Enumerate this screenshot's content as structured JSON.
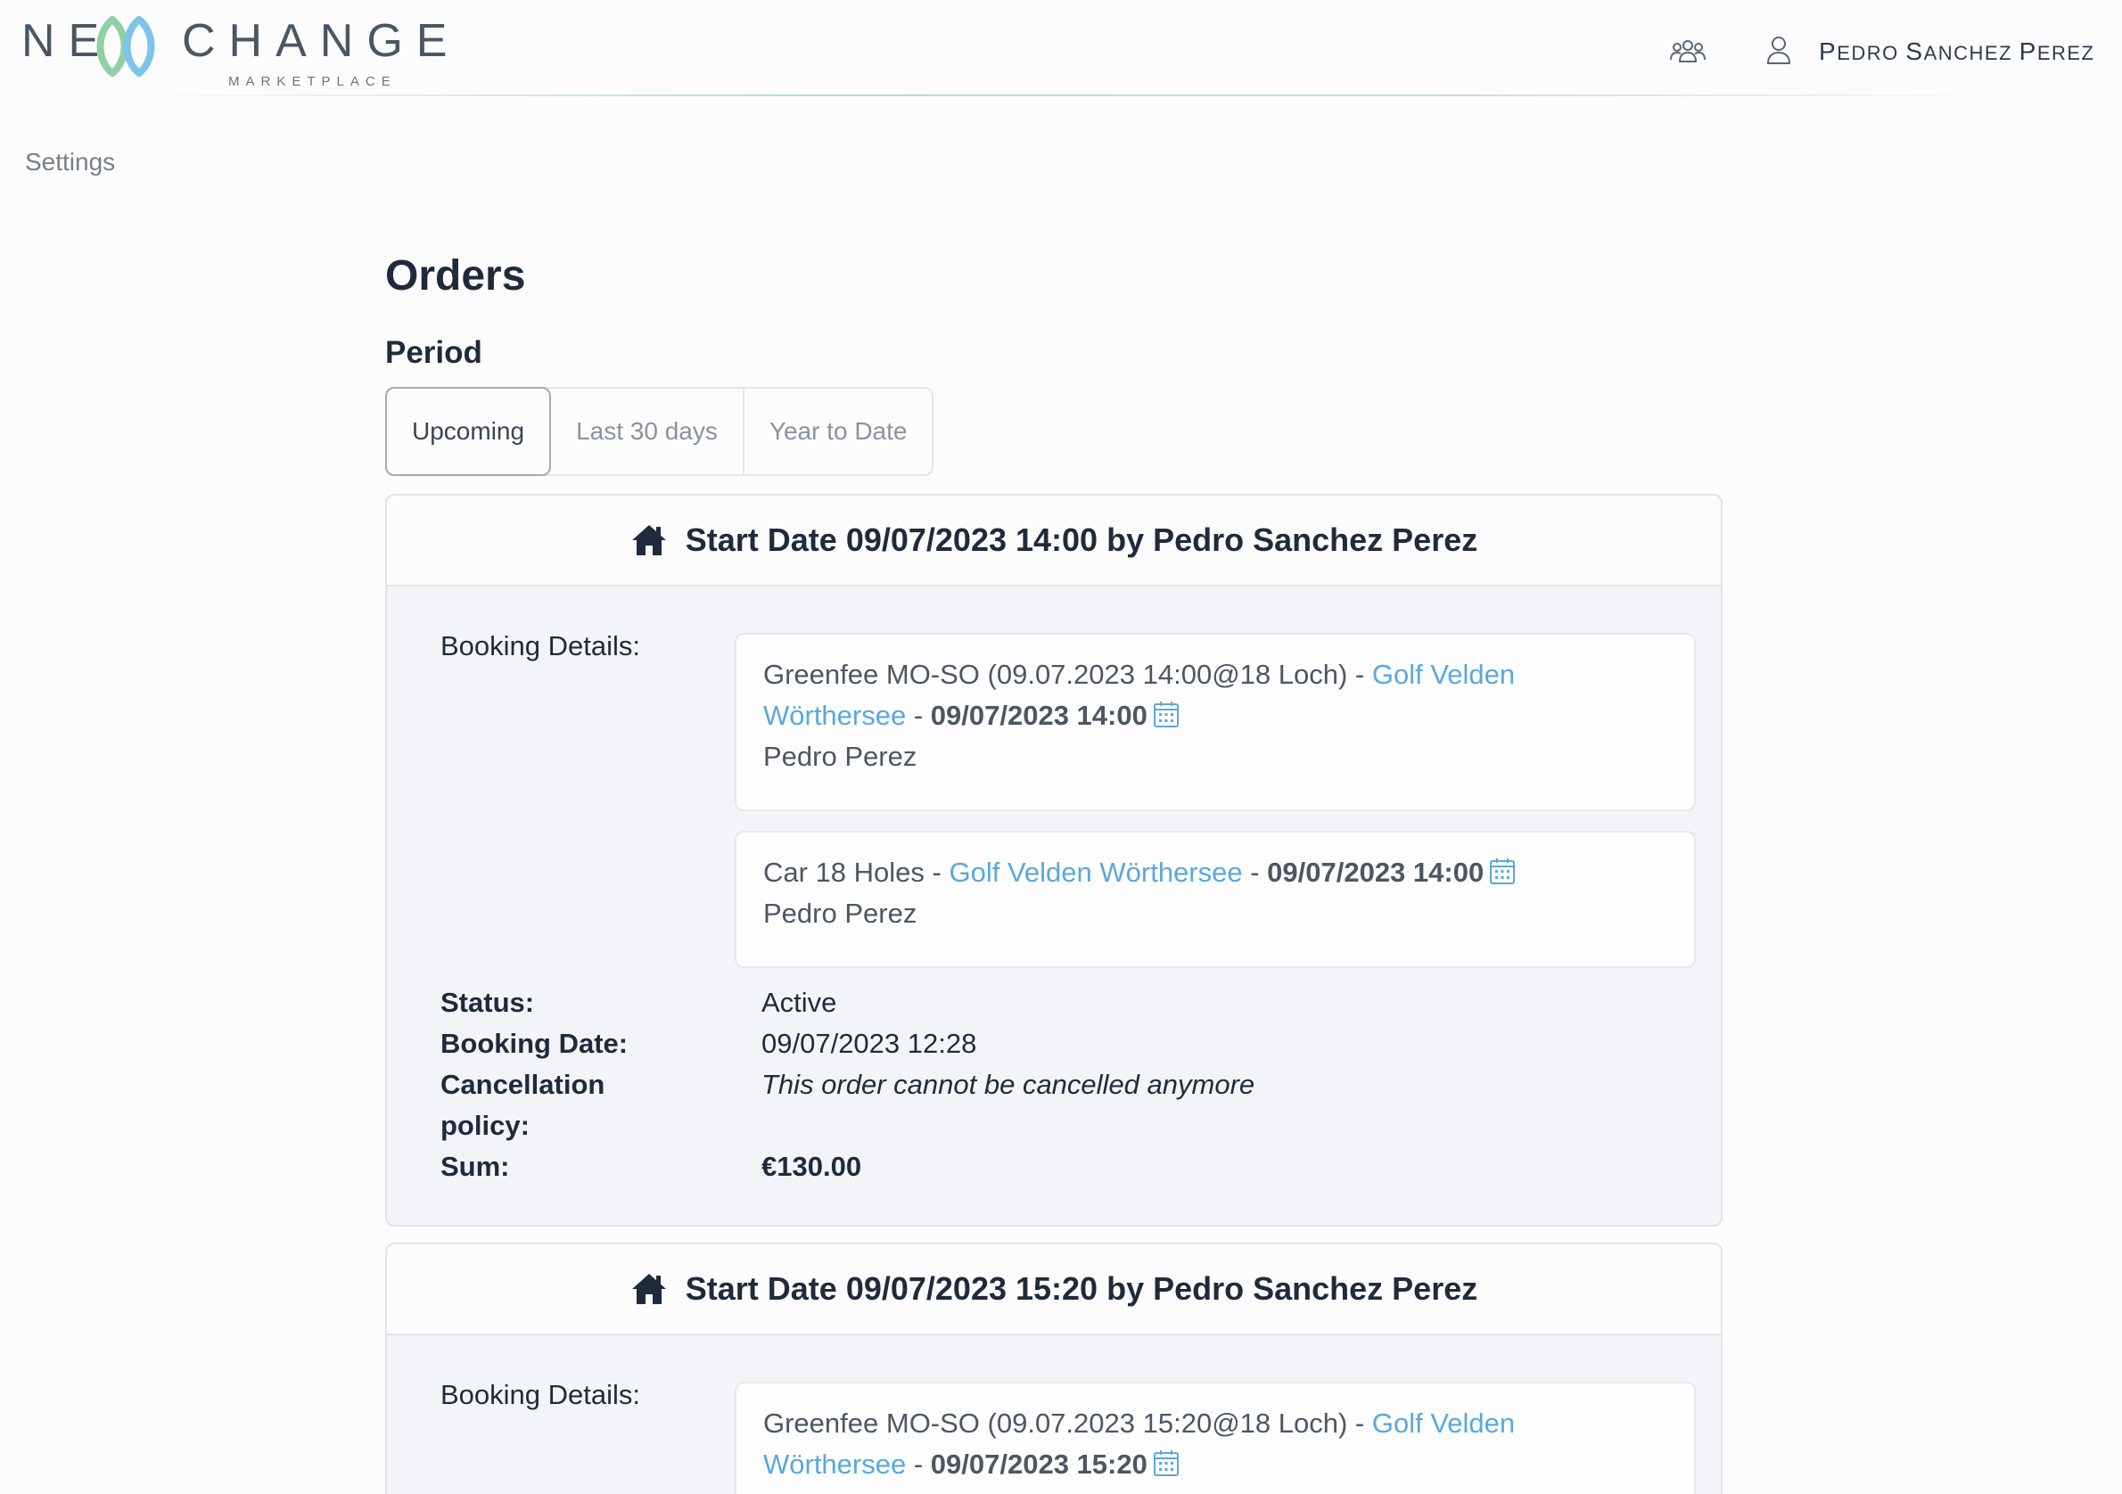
{
  "brand": {
    "logo_text_left": "NE",
    "logo_text_right": "CHANGE",
    "logo_sub": "MARKETPLACE"
  },
  "header": {
    "user_name_parts": [
      {
        "big": "P",
        "small": "EDRO "
      },
      {
        "big": "S",
        "small": "ANCHEZ "
      },
      {
        "big": "P",
        "small": "EREZ"
      }
    ],
    "icons": [
      "group-icon",
      "user-icon"
    ]
  },
  "nav": {
    "settings": "Settings"
  },
  "page": {
    "title": "Orders",
    "period_label": "Period"
  },
  "tabs": [
    {
      "label": "Upcoming",
      "active": true
    },
    {
      "label": "Last 30 days",
      "active": false
    },
    {
      "label": "Year to Date",
      "active": false
    }
  ],
  "orders": [
    {
      "header": "Start Date 09/07/2023 14:00 by Pedro Sanchez Perez",
      "booking_label": "Booking Details:",
      "items": [
        {
          "title": "Greenfee MO-SO (09.07.2023 14:00@18 Loch)",
          "sep1": " - ",
          "venue_line1": "Golf Velden",
          "venue_line2": "Wörthersee",
          "sep2": " - ",
          "datetime": "09/07/2023 14:00",
          "guest": "Pedro Perez"
        },
        {
          "title": "Car 18 Holes",
          "sep1": " - ",
          "venue": "Golf Velden Wörthersee",
          "sep2": " - ",
          "datetime": "09/07/2023 14:00",
          "guest": "Pedro Perez"
        }
      ],
      "status_label": "Status:",
      "status": "Active",
      "booking_date_label": "Booking Date:",
      "booking_date": "09/07/2023 12:28",
      "cancellation_label_1": "Cancellation",
      "cancellation_label_2": "policy:",
      "cancellation": "This order cannot be cancelled anymore",
      "sum_label": "Sum:",
      "sum": "€130.00"
    },
    {
      "header": "Start Date 09/07/2023 15:20 by Pedro Sanchez Perez",
      "booking_label": "Booking Details:",
      "items": [
        {
          "title": "Greenfee MO-SO (09.07.2023 15:20@18 Loch)",
          "sep1": " - ",
          "venue_line1": "Golf Velden",
          "venue_line2": "Wörthersee",
          "sep2": " - ",
          "datetime": "09/07/2023 15:20"
        }
      ]
    }
  ],
  "colors": {
    "link": "#5aa8dc",
    "text": "#1f2a3c",
    "muted": "#8a929c",
    "card_bg": "#f3f4f7"
  }
}
